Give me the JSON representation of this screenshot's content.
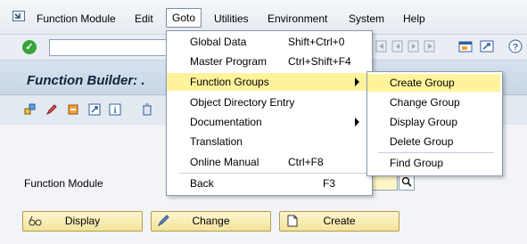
{
  "menubar": {
    "items": [
      "Function Module",
      "Edit",
      "Goto",
      "Utilities",
      "Environment",
      "System",
      "Help"
    ]
  },
  "page": {
    "title": "Function Builder: ."
  },
  "form": {
    "function_module_label": "Function Module",
    "function_module_value": ""
  },
  "buttons": {
    "display": "Display",
    "change": "Change",
    "create": "Create"
  },
  "goto_menu": {
    "items": [
      {
        "label": "Global Data",
        "shortcut": "Shift+Ctrl+0"
      },
      {
        "label": "Master Program",
        "shortcut": "Ctrl+Shift+F4"
      },
      {
        "label": "Function Groups",
        "shortcut": ""
      },
      {
        "label": "Object Directory Entry",
        "shortcut": ""
      },
      {
        "label": "Documentation",
        "shortcut": ""
      },
      {
        "label": "Translation",
        "shortcut": ""
      },
      {
        "label": "Online Manual",
        "shortcut": "Ctrl+F8"
      },
      {
        "label": "Back",
        "shortcut": "F3"
      }
    ]
  },
  "function_groups_submenu": {
    "items": [
      "Create Group",
      "Change Group",
      "Display Group",
      "Delete Group",
      "Find Group"
    ]
  },
  "colors": {
    "highlight": "#fff39b",
    "button_bg": "#f3e49a",
    "title_bar": "#c8d6e6"
  }
}
